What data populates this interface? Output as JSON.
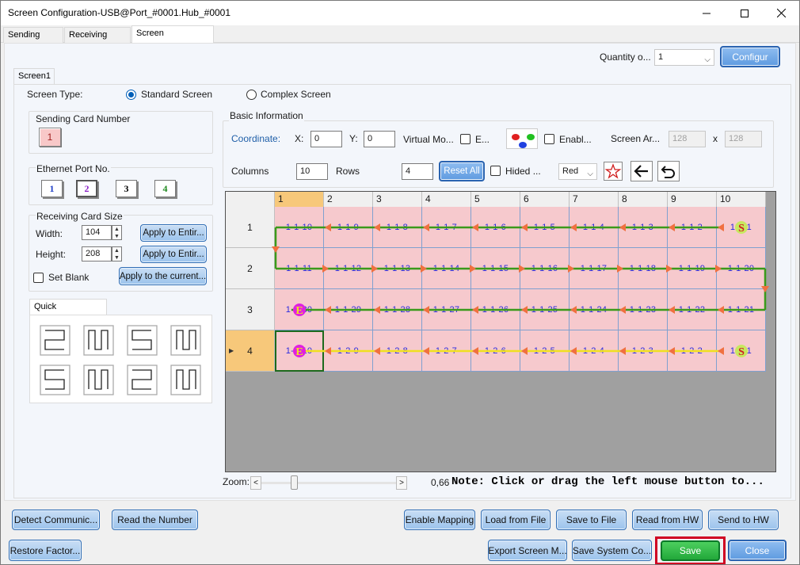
{
  "window": {
    "title": "Screen Configuration-USB@Port_#0001.Hub_#0001"
  },
  "tabs": [
    {
      "label": "Sending Card",
      "active": false
    },
    {
      "label": "Receiving Card",
      "active": false
    },
    {
      "label": "Screen Connection",
      "active": true
    }
  ],
  "top": {
    "quantity_label": "Quantity o...",
    "quantity_value": "1",
    "configure_label": "Configur"
  },
  "screen_tab": {
    "label": "Screen1"
  },
  "screen_type": {
    "label": "Screen Type:",
    "standard": "Standard Screen",
    "complex": "Complex Screen",
    "selected": "standard"
  },
  "sending_card": {
    "title": "Sending Card Number",
    "value": "1"
  },
  "ethernet": {
    "title": "Ethernet Port No.",
    "ports": [
      "1",
      "2",
      "3",
      "4"
    ],
    "selected": "2",
    "port_colors": [
      "#1f3fc7",
      "#8a1fc7",
      "#000000",
      "#1f8a1f"
    ]
  },
  "receiving_card_size": {
    "title": "Receiving Card Size",
    "width_label": "Width:",
    "width_value": "104",
    "height_label": "Height:",
    "height_value": "208",
    "apply_entire_label": "Apply to Entir...",
    "set_blank_label": "Set Blank",
    "apply_current_label": "Apply to the current..."
  },
  "quick_connection": {
    "title": "Quick Connection"
  },
  "basic_info": {
    "title": "Basic Information",
    "coordinate_label": "Coordinate:",
    "x_label": "X:",
    "x_value": "0",
    "y_label": "Y:",
    "y_value": "0",
    "virtual_label": "Virtual Mo...",
    "e_label": "E...",
    "enable_label": "Enabl...",
    "screen_area_label": "Screen Ar...",
    "screen_w": "128",
    "screen_x": "x",
    "screen_h": "128",
    "columns_label": "Columns",
    "columns_value": "10",
    "rows_label": "Rows",
    "rows_value": "4",
    "reset_all_label": "Reset All",
    "hided_label": "Hided ...",
    "color_value": "Red"
  },
  "grid": {
    "columns": [
      "1",
      "2",
      "3",
      "4",
      "5",
      "6",
      "7",
      "8",
      "9",
      "10"
    ],
    "rows": [
      "1",
      "2",
      "3",
      "4"
    ],
    "selected_column": "1",
    "selected_row": "4",
    "cells": [
      [
        "1-1-10",
        "1-1-9",
        "1-1-8",
        "1-1-7",
        "1-1-6",
        "1-1-5",
        "1-1-4",
        "1-1-3",
        "1-1-2",
        "1-1-1"
      ],
      [
        "1-1-11",
        "1-1-12",
        "1-1-13",
        "1-1-14",
        "1-1-15",
        "1-1-16",
        "1-1-17",
        "1-1-18",
        "1-1-19",
        "1-1-20"
      ],
      [
        "1-1-30",
        "1-1-29",
        "1-1-28",
        "1-1-27",
        "1-1-26",
        "1-1-25",
        "1-1-24",
        "1-1-23",
        "1-1-22",
        "1-1-21"
      ],
      [
        "1-2-10",
        "1-2-9",
        "1-2-8",
        "1-2-7",
        "1-2-6",
        "1-2-5",
        "1-2-4",
        "1-2-3",
        "1-2-2",
        "1-2-1"
      ]
    ],
    "start_marker": "S",
    "end_marker": "E",
    "line_colors": {
      "port1": "#3a9a1a",
      "port2": "#f0e020",
      "arrow": "#f07040"
    }
  },
  "zoom": {
    "label": "Zoom:",
    "value": "0,66",
    "left": "<",
    "right": ">"
  },
  "note": "Note: Click or drag the left mouse button to...",
  "buttons_row1": {
    "detect": "Detect Communic...",
    "read_number": "Read the Number",
    "enable_mapping": "Enable Mapping",
    "load_file": "Load from File",
    "save_file": "Save to File",
    "read_hw": "Read from HW",
    "send_hw": "Send to HW"
  },
  "buttons_row2": {
    "restore": "Restore Factor...",
    "export": "Export Screen M...",
    "save_system": "Save System Co...",
    "save": "Save",
    "close": "Close"
  }
}
